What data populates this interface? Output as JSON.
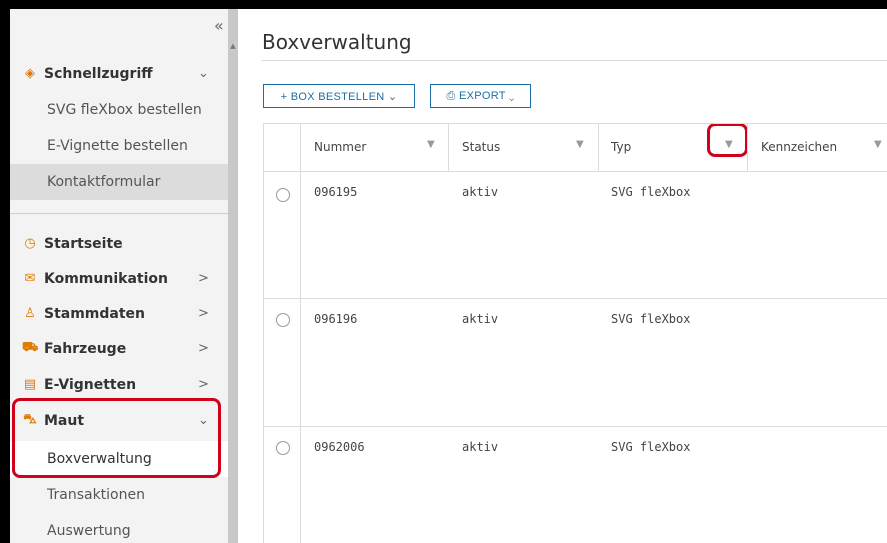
{
  "sidebar": {
    "collapse_glyph": "«",
    "quick_access": {
      "label": "Schnellzugriff",
      "items": [
        "SVG fleXbox bestellen",
        "E-Vignette bestellen",
        "Kontaktformular"
      ]
    },
    "groups": [
      {
        "label": "Startseite",
        "icon": "gauge-icon"
      },
      {
        "label": "Kommunikation",
        "icon": "envelope-icon"
      },
      {
        "label": "Stammdaten",
        "icon": "user-icon"
      },
      {
        "label": "Fahrzeuge",
        "icon": "car-icon"
      },
      {
        "label": "E-Vignetten",
        "icon": "vignette-icon"
      },
      {
        "label": "Maut",
        "icon": "truck-icon"
      }
    ],
    "maut_items": [
      "Boxverwaltung",
      "Transaktionen",
      "Auswertung"
    ]
  },
  "main": {
    "title": "Boxverwaltung",
    "toolbar": {
      "order_label": "+ BOX BESTELLEN ⌄",
      "export_label": "⎙ EXPORT ⌄"
    },
    "table": {
      "columns": [
        "Nummer",
        "Status",
        "Typ",
        "Kennzeichen"
      ],
      "rows": [
        {
          "nummer": "096195",
          "status": "aktiv",
          "typ": "SVG fleXbox",
          "kennzeichen": ""
        },
        {
          "nummer": "096196",
          "status": "aktiv",
          "typ": "SVG fleXbox",
          "kennzeichen": ""
        },
        {
          "nummer": "0962006",
          "status": "aktiv",
          "typ": "SVG fleXbox",
          "kennzeichen": ""
        }
      ]
    }
  },
  "colors": {
    "accent": "#1c6fa4",
    "icon_orange": "#e07b00",
    "highlight_red": "#d0021b"
  }
}
